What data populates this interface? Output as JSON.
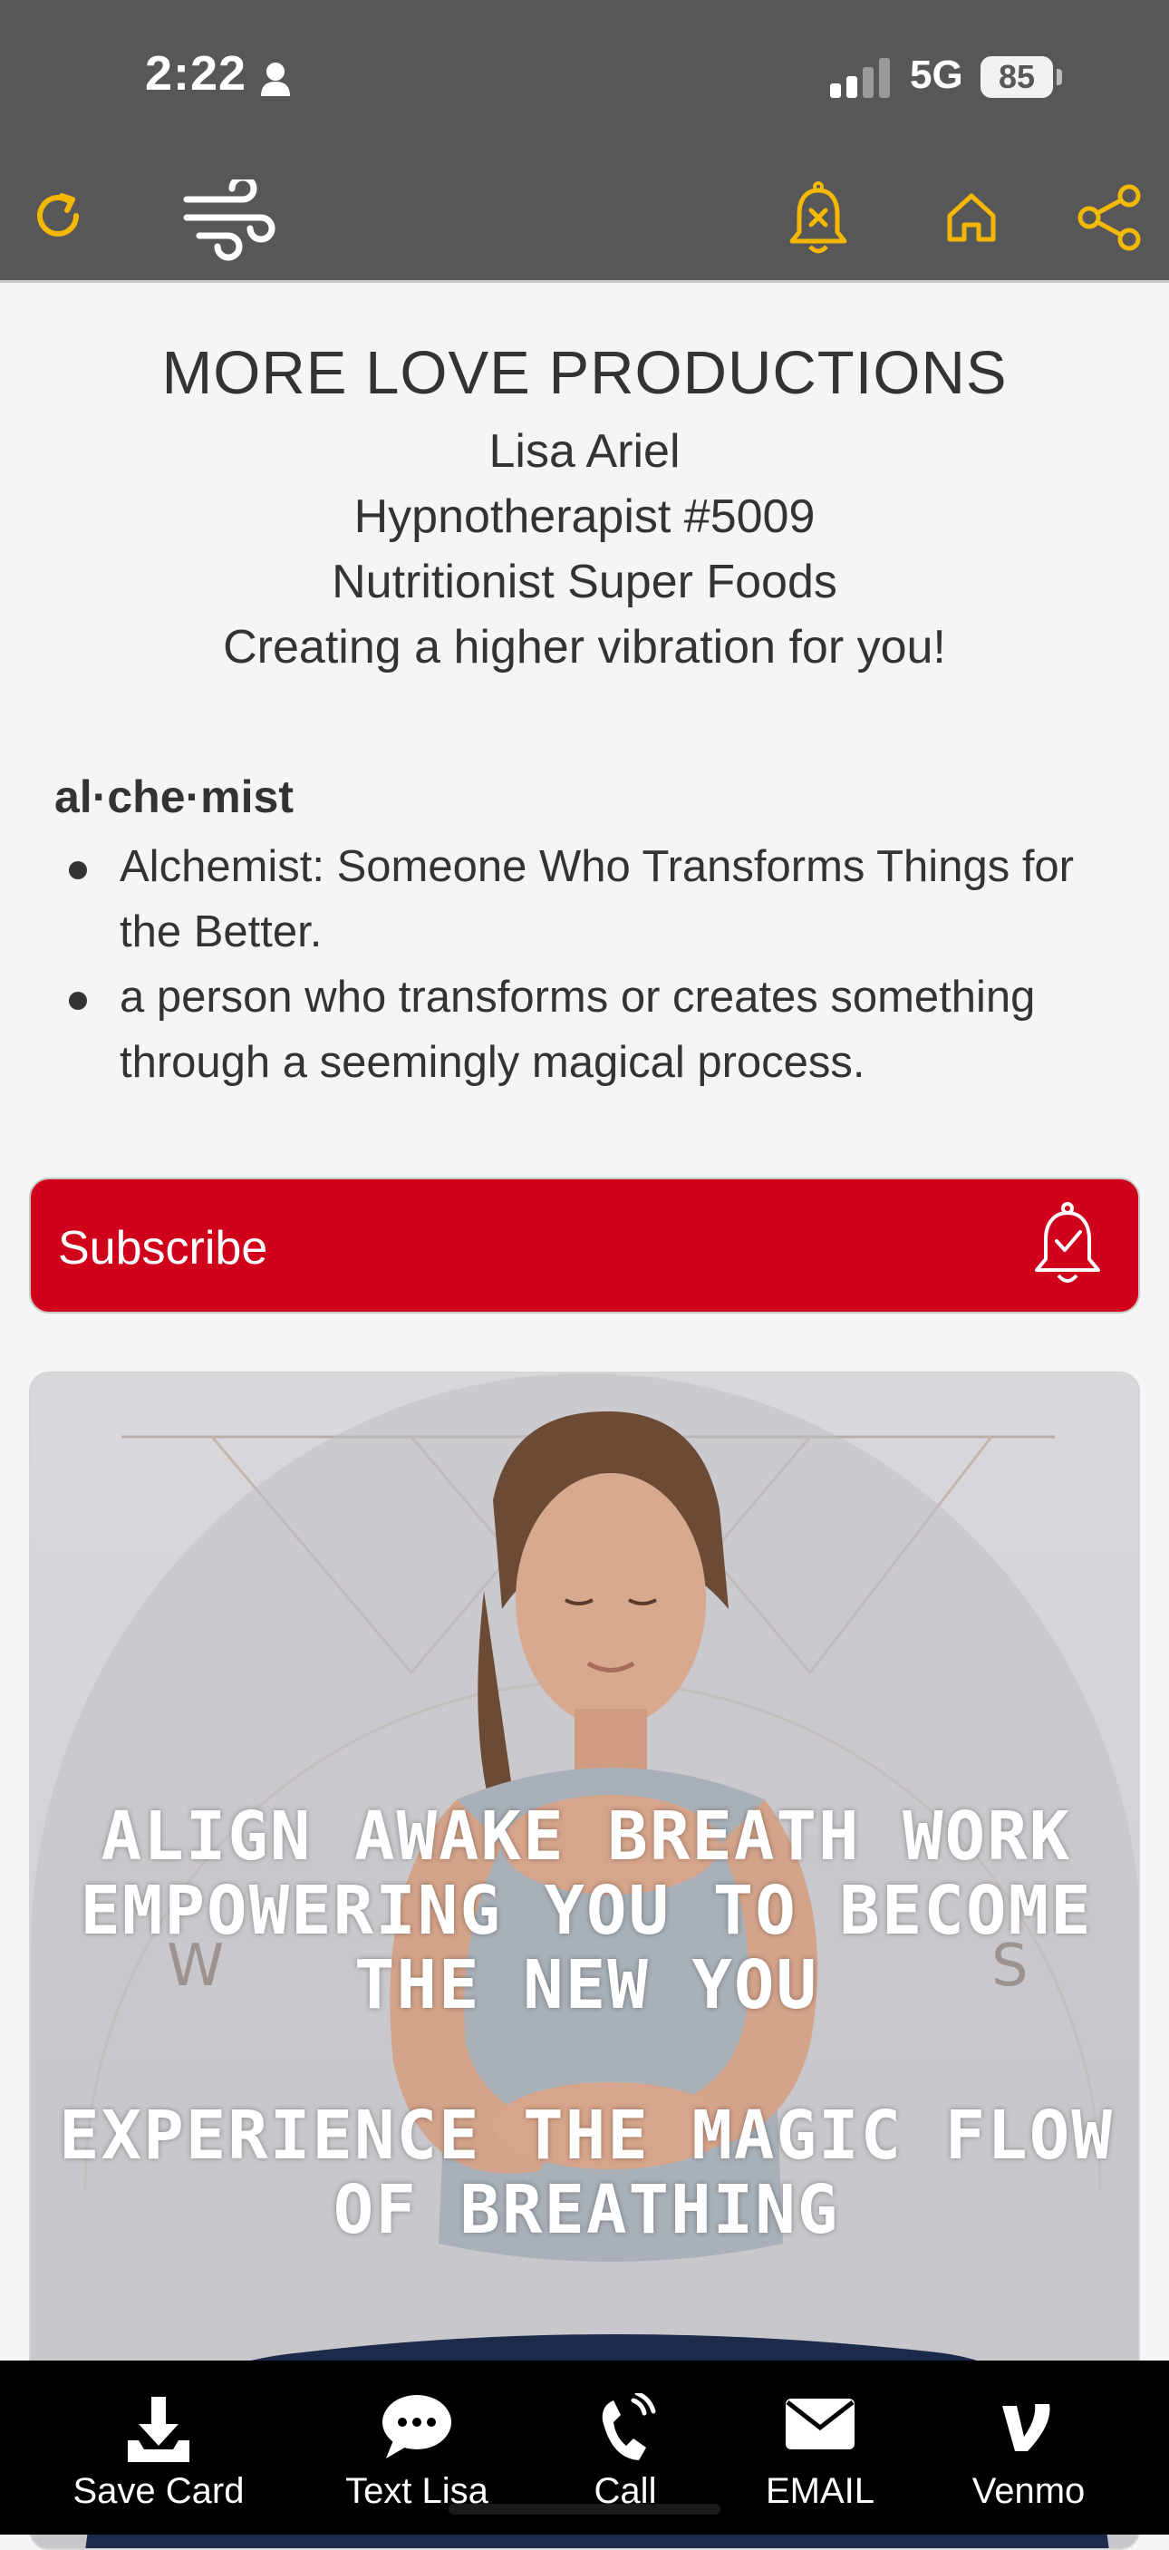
{
  "status_bar": {
    "time": "2:22",
    "network": "5G",
    "battery": "85"
  },
  "toolbar": {
    "accent_color": "#f5b800",
    "icons": [
      "refresh-icon",
      "wind-icon",
      "notifications-off-icon",
      "home-icon",
      "share-icon"
    ]
  },
  "header": {
    "brand": "MORE LOVE PRODUCTIONS",
    "lines": [
      "Lisa Ariel",
      "Hypnotherapist #5009",
      "Nutritionist Super Foods",
      "Creating a higher vibration for you!"
    ]
  },
  "definition": {
    "term": "al·che·mist",
    "items": [
      "Alchemist: Someone Who Transforms Things for the Better.",
      "a person who transforms or creates something through a seemingly magical process."
    ]
  },
  "subscribe": {
    "label": "Subscribe",
    "color": "#d0021b",
    "icon": "bell-check-icon"
  },
  "hero": {
    "headline": "Align Awake Breath Work Empowering You to Become the New You",
    "subheadline": "Experience the Magic Flow of Breathing",
    "background_letters": [
      "W",
      "S"
    ]
  },
  "bottom_bar": {
    "actions": [
      {
        "label": "Save Card",
        "icon": "download-icon"
      },
      {
        "label": "Text Lisa",
        "icon": "chat-icon"
      },
      {
        "label": "Call",
        "icon": "phone-icon"
      },
      {
        "label": "EMAIL",
        "icon": "envelope-icon"
      },
      {
        "label": "Venmo",
        "icon": "venmo-icon"
      }
    ]
  }
}
